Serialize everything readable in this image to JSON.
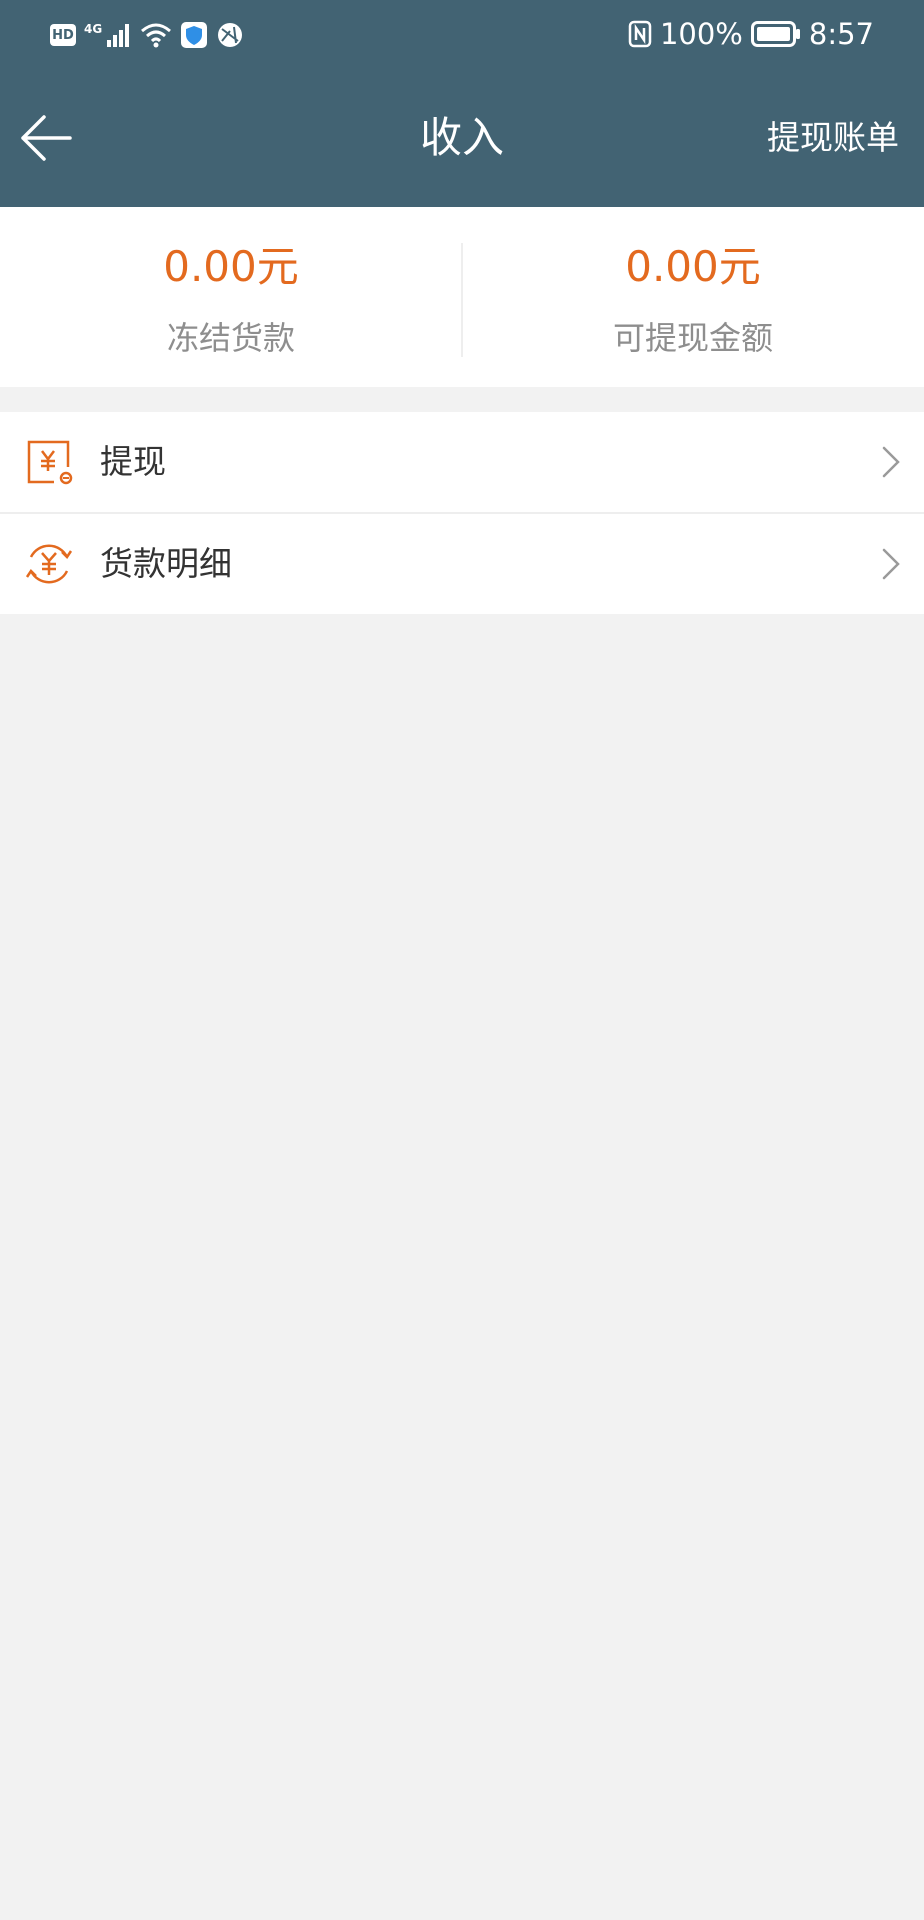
{
  "status_bar": {
    "hd": "HD",
    "network": "4G",
    "battery_percent": "100%",
    "time": "8:57",
    "icons": [
      "hd-icon",
      "signal-icon",
      "wifi-icon",
      "shield-app-icon",
      "vpn-globe-icon",
      "nfc-icon",
      "battery-icon"
    ]
  },
  "nav": {
    "title": "收入",
    "action": "提现账单",
    "back_icon": "arrow-left-icon"
  },
  "summary": {
    "frozen_amount": "0.00元",
    "frozen_label": "冻结货款",
    "available_amount": "0.00元",
    "available_label": "可提现金额"
  },
  "menu": {
    "items": [
      {
        "label": "提现",
        "icon": "yuan-withdraw-icon"
      },
      {
        "label": "货款明细",
        "icon": "yuan-cycle-icon"
      }
    ]
  },
  "colors": {
    "header": "#426373",
    "accent": "#e36a1f",
    "background": "#f2f2f2"
  }
}
